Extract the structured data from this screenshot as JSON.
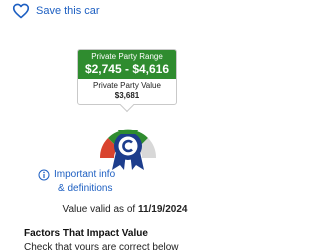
{
  "save": {
    "label": "Save this car",
    "icon": "heart-outline-icon"
  },
  "price_card": {
    "range_label": "Private Party Range",
    "range_value": "$2,745 - $4,616",
    "value_label": "Private Party Value",
    "value": "$3,681"
  },
  "gauge": {
    "colors": {
      "red": "#d9442f",
      "green": "#2f8c2f",
      "gray": "#d8d8d8",
      "ribbon": "#1d3d8c"
    },
    "icon": "kbb-ribbon-badge-icon"
  },
  "info": {
    "line1": "Important info",
    "line2": "& definitions",
    "icon": "info-circle-icon"
  },
  "valid": {
    "prefix": "Value valid as of",
    "date": "11/19/2024"
  },
  "factors": {
    "title": "Factors That Impact Value",
    "subtitle": "Check that yours are correct below"
  },
  "colors": {
    "link": "#1d5fc2",
    "brand_green": "#2f8c2f"
  }
}
